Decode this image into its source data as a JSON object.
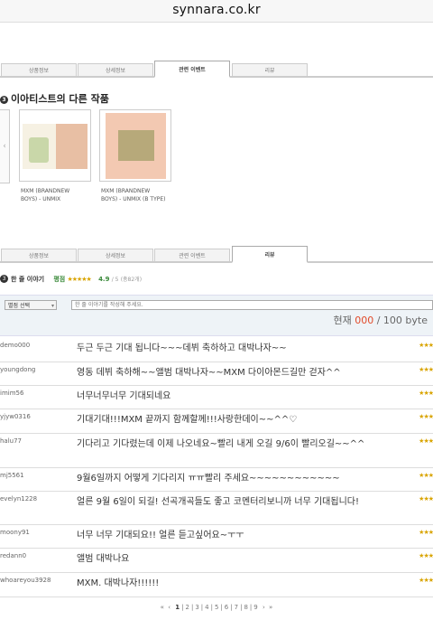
{
  "browser": {
    "url": "synnara.co.kr"
  },
  "tabs_top": [
    {
      "label": "상품정보"
    },
    {
      "label": "상세정보"
    },
    {
      "label": "관련 이벤트"
    },
    {
      "label": "리뷰"
    }
  ],
  "other_works": {
    "title": "이아티스트의 다른 작품",
    "bullet": "3",
    "prev_arrow": "‹",
    "albums": [
      {
        "caption": "MXM (BRANDNEW BOYS) - UNMIX"
      },
      {
        "caption": "MXM (BRANDNEW BOYS) - UNMIX (B TYPE)"
      }
    ]
  },
  "tabs_bottom": [
    {
      "label": "상품정보"
    },
    {
      "label": "상세정보"
    },
    {
      "label": "관련 이벤트"
    },
    {
      "label": "리뷰"
    }
  ],
  "review": {
    "bullet": "3",
    "title": "한 줄 이야기",
    "rating_label": "평점",
    "stars": "★★★★★",
    "score": "4.9",
    "score_max": "/ 5",
    "total": "(총82개)",
    "select_label": "별점 선택",
    "placeholder": "한 줄 이야기를 작성해 주세요.",
    "counter_prefix": "현재",
    "counter_current": "000",
    "counter_suffix": "/ 100 byte"
  },
  "comments": [
    {
      "user": "demo000",
      "text": "두근 두근 기대 됩니다~~~데뷔 축하하고 대박나자~~",
      "stars": "★★★"
    },
    {
      "user": "youngdong",
      "text": "영동 데뷔 축하해~~앨범 대박나자~~MXM 다이아몬드길만 걷자^^",
      "stars": "★★★"
    },
    {
      "user": "imim56",
      "text": "너무너무너무 기대되네요",
      "stars": "★★★"
    },
    {
      "user": "yjyw0316",
      "text": "기대기대!!!MXM 끝까지 함께할께!!!사랑한데이~~^^♡",
      "stars": "★★★"
    },
    {
      "user": "halu77",
      "text": "기다리고 기다렸는데 이제 나오네요~빨리 내게 오길 9/6이 빨리오길~~^^",
      "stars": "★★★"
    },
    {
      "user": "mj5561",
      "text": "9월6일까지 어떻게 기다리지 ㅠㅠ빨리 주세요~~~~~~~~~~~~",
      "stars": "★★★"
    },
    {
      "user": "evelyn1228",
      "text": "얼른 9월 6일이 되길! 선곡개곡들도 좋고 코멘터리보니까 너무 기대됩니다!",
      "stars": "★★★"
    },
    {
      "user": "moony91",
      "text": "너무 너무 기대되요!! 얼른 듣고싶어요~ㅜㅜ",
      "stars": "★★★"
    },
    {
      "user": "redann0",
      "text": "앨범 대박나요",
      "stars": "★★★"
    },
    {
      "user": "whoareyou3928",
      "text": "MXM. 대박나자!!!!!!",
      "stars": "★★★"
    }
  ],
  "pagination": {
    "first": "«",
    "prev": "‹",
    "pages": [
      "1",
      "2",
      "3",
      "4",
      "5",
      "6",
      "7",
      "8",
      "9"
    ],
    "next": "›",
    "last": "»"
  }
}
